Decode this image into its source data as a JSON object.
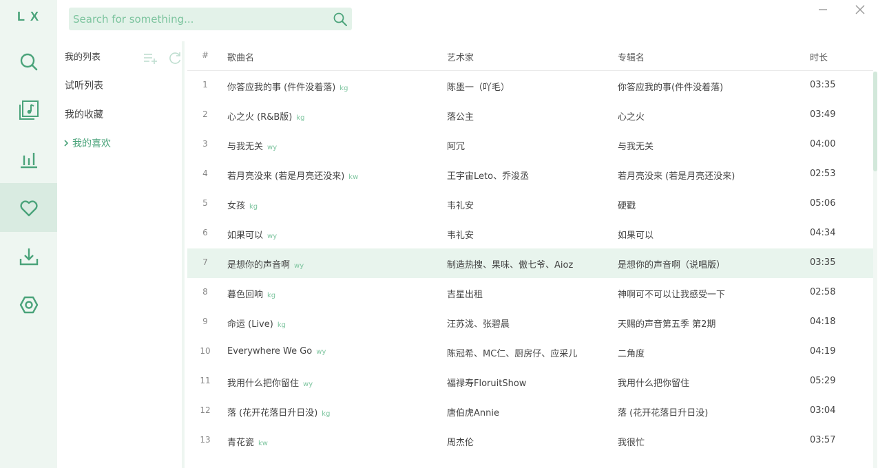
{
  "app": {
    "logo": "LX"
  },
  "colors": {
    "accent": "#4aa37a",
    "rail_bg": "#eef6f1",
    "highlight": "#e8f4ed"
  },
  "nav": {
    "items": [
      {
        "icon": "search-icon",
        "active": false
      },
      {
        "icon": "music-library-icon",
        "active": false
      },
      {
        "icon": "leaderboard-icon",
        "active": false
      },
      {
        "icon": "heart-icon",
        "active": true
      },
      {
        "icon": "download-icon",
        "active": false
      },
      {
        "icon": "settings-icon",
        "active": false
      }
    ]
  },
  "search": {
    "placeholder": "Search for something..."
  },
  "lists": {
    "header": "我的列表",
    "items": [
      "试听列表",
      "我的收藏",
      "我的喜欢"
    ],
    "active_index": 2
  },
  "table": {
    "columns": {
      "num": "#",
      "name": "歌曲名",
      "artist": "艺术家",
      "album": "专辑名",
      "duration": "时长"
    },
    "rows": [
      {
        "num": "1",
        "name": "你答应我的事 (件件没着落)",
        "src": "kg",
        "artist": "陈墨一（吖毛）",
        "album": "你答应我的事(件件没着落)",
        "duration": "03:35"
      },
      {
        "num": "2",
        "name": "心之火 (R&B版)",
        "src": "kg",
        "artist": "落公主",
        "album": "心之火",
        "duration": "03:49"
      },
      {
        "num": "3",
        "name": "与我无关",
        "src": "wy",
        "artist": "阿冗",
        "album": "与我无关",
        "duration": "04:00"
      },
      {
        "num": "4",
        "name": "若月亮没来 (若是月亮还没来)",
        "src": "kw",
        "artist": "王宇宙Leto、乔浚丞",
        "album": "若月亮没来 (若是月亮还没来)",
        "duration": "02:53"
      },
      {
        "num": "5",
        "name": "女孩",
        "src": "kg",
        "artist": "韦礼安",
        "album": "硬戳",
        "duration": "05:06"
      },
      {
        "num": "6",
        "name": "如果可以",
        "src": "wy",
        "artist": "韦礼安",
        "album": "如果可以",
        "duration": "04:34"
      },
      {
        "num": "7",
        "name": "是想你的声音啊",
        "src": "wy",
        "artist": "制造热搜、果味、傲七爷、Aioz",
        "album": "是想你的声音啊（说唱版）",
        "duration": "03:35"
      },
      {
        "num": "8",
        "name": "暮色回响",
        "src": "kg",
        "artist": "吉星出租",
        "album": "神啊可不可以让我感受一下",
        "duration": "02:58"
      },
      {
        "num": "9",
        "name": "命运 (Live)",
        "src": "kg",
        "artist": "汪苏泷、张碧晨",
        "album": "天赐的声音第五季 第2期",
        "duration": "04:18"
      },
      {
        "num": "10",
        "name": "Everywhere We Go",
        "src": "wy",
        "artist": "陈冠希、MC仁、厨房仔、应采儿",
        "album": "二角度",
        "duration": "04:19"
      },
      {
        "num": "11",
        "name": "我用什么把你留住",
        "src": "wy",
        "artist": "福禄寿FloruitShow",
        "album": "我用什么把你留住",
        "duration": "05:29"
      },
      {
        "num": "12",
        "name": "落 (花开花落日升日没)",
        "src": "kg",
        "artist": "唐伯虎Annie",
        "album": "落 (花开花落日升日没)",
        "duration": "03:04"
      },
      {
        "num": "13",
        "name": "青花瓷",
        "src": "kw",
        "artist": "周杰伦",
        "album": "我很忙",
        "duration": "03:57"
      }
    ],
    "highlighted_index": 6
  }
}
